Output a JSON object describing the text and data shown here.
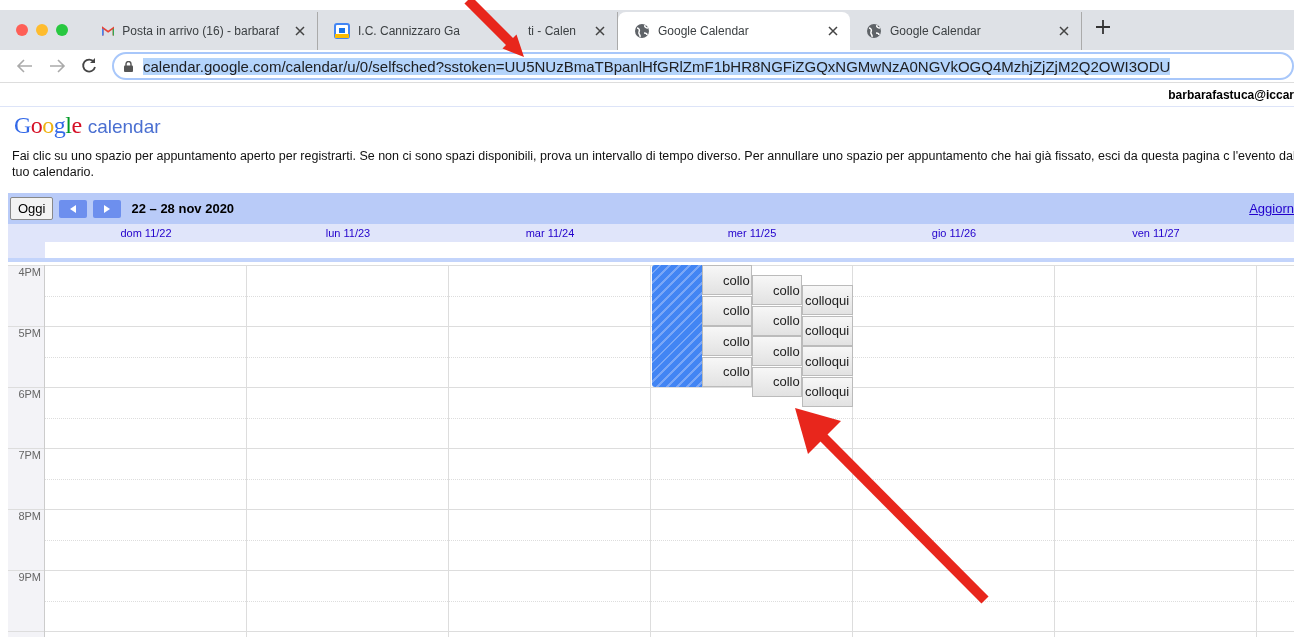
{
  "browser": {
    "tabs": [
      {
        "title": "Posta in arrivo (16) - barbaraf",
        "kind": "mail",
        "selected": false
      },
      {
        "title": "I.C. Cannizzaro Ga",
        "title_after_arrow": "ti - Calen",
        "kind": "calendar",
        "selected": false
      },
      {
        "title": "Google Calendar",
        "kind": "globe",
        "selected": true
      },
      {
        "title": "Google Calendar",
        "kind": "globe",
        "selected": false
      }
    ],
    "address_bar": {
      "url": "calendar.google.com/calendar/u/0/selfsched?sstoken=UU5NUzBmaTBpanlHfGRlZmF1bHR8NGFiZGQxNGMwNzA0NGVkOGQ4MzhjZjZjM2Q2OWI3ODU",
      "selected": true
    }
  },
  "page": {
    "account": "barbarafastuca@iccar",
    "logo": {
      "brand": "Google",
      "product": "calendar"
    },
    "instructions": "Fai clic su uno spazio per appuntamento aperto per registrarti. Se non ci sono spazi disponibili, prova un intervallo di tempo diverso. Per annullare uno spazio per appuntamento che hai già fissato, esci da questa pagina c l'evento dal tuo calendario.",
    "toolbar": {
      "today_button": "Oggi",
      "date_range": "22 – 28 nov 2020",
      "refresh_link": "Aggiorn"
    },
    "days": [
      "dom 11/22",
      "lun 11/23",
      "mar 11/24",
      "mer 11/25",
      "gio 11/26",
      "ven 11/27"
    ],
    "hours": [
      "4PM",
      "5PM",
      "6PM",
      "7PM",
      "8PM",
      "9PM"
    ],
    "events": {
      "slot_columns": [
        {
          "labels": [
            "collo",
            "collo",
            "collo",
            "collo"
          ]
        },
        {
          "labels": [
            "collo",
            "collo",
            "collo",
            "collo"
          ]
        },
        {
          "labels": [
            "colloqui",
            "colloqui",
            "colloqui",
            "colloqui"
          ]
        }
      ]
    }
  }
}
